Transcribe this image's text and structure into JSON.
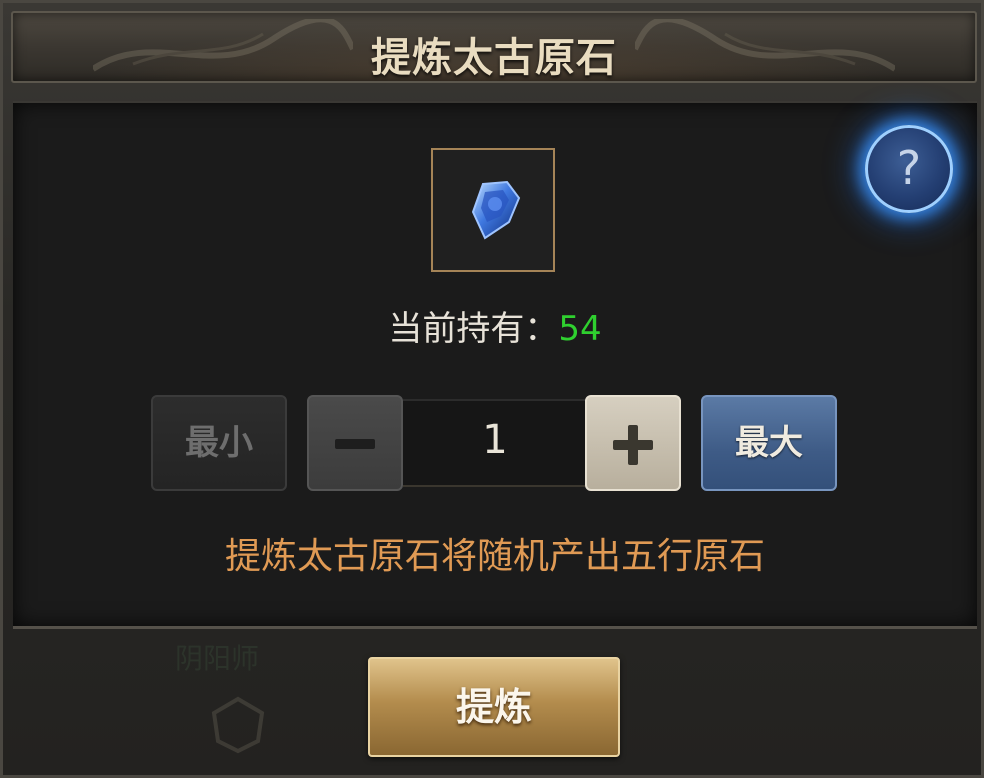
{
  "dialog": {
    "title": "提炼太古原石"
  },
  "item": {
    "icon": "blue-gem-icon",
    "holding_label": "当前持有：",
    "holding_value": "54"
  },
  "help": {
    "symbol": "?"
  },
  "quantity": {
    "min_label": "最小",
    "max_label": "最大",
    "value": "1"
  },
  "hint": "提炼太古原石将随机产出五行原石",
  "background": {
    "faint_label": "阴阳师"
  },
  "actions": {
    "refine_label": "提炼"
  },
  "colors": {
    "holding_value": "#2fd02f",
    "hint": "#e09a54",
    "max_button": "#3e5b86",
    "refine_button": "#b38c4d",
    "help_glow": "#3c96ff"
  }
}
